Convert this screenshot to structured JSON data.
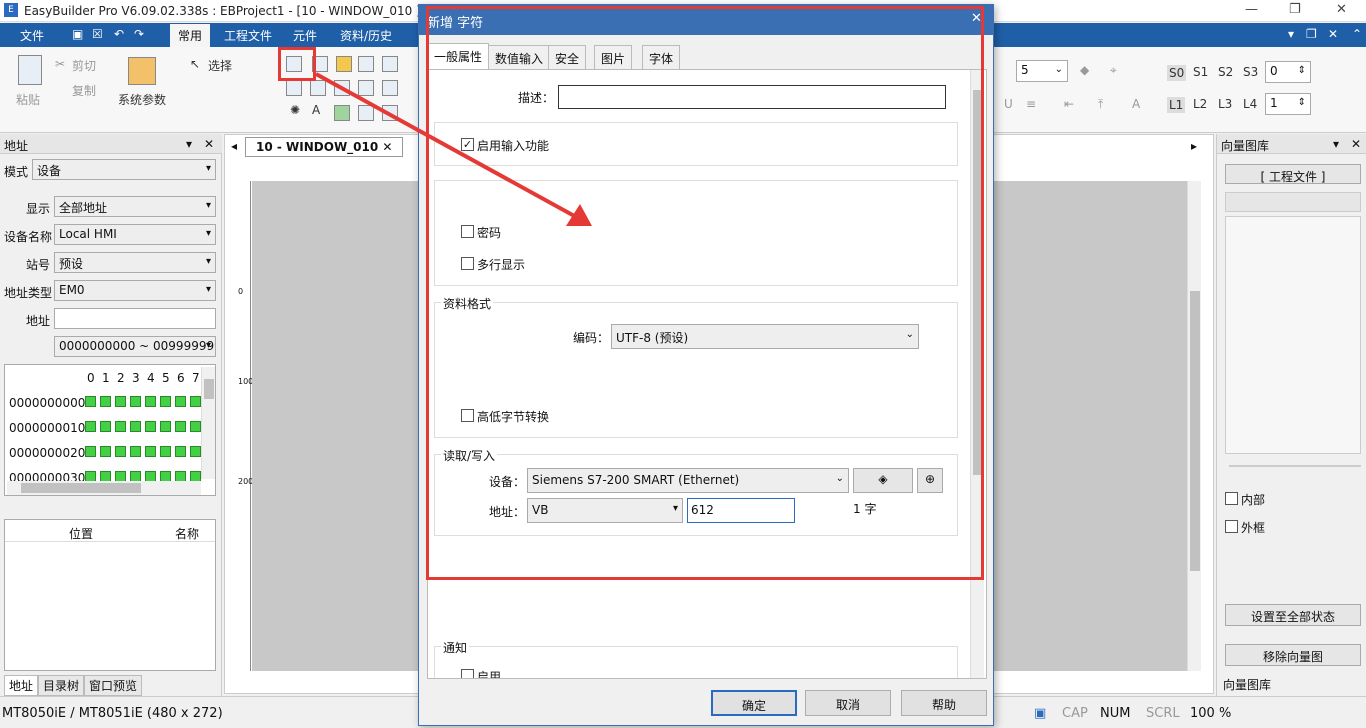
{
  "app": {
    "title": "EasyBuilder Pro V6.09.02.338s : EBProject1 - [10 - WINDOW_010 ]"
  },
  "menu": {
    "items": [
      "文件",
      "常用",
      "工程文件",
      "元件",
      "资料/历史"
    ]
  },
  "ribbon": {
    "paste": "粘贴",
    "cut": "剪切",
    "copy": "复制",
    "system_params": "系统参数",
    "select": "选择",
    "font_size": "5",
    "s_labels": [
      "S0",
      "S1",
      "S2",
      "S3"
    ],
    "s_value": "0",
    "l_labels": [
      "L1",
      "L2",
      "L3",
      "L4"
    ],
    "l_value": "1"
  },
  "left_panel": {
    "title": "地址",
    "mode_label": "模式",
    "mode_value": "设备",
    "display_label": "显示",
    "display_value": "全部地址",
    "device_name_label": "设备名称",
    "device_name_value": "Local HMI",
    "station_label": "站号",
    "station_value": "预设",
    "addr_type_label": "地址类型",
    "addr_type_value": "EM0",
    "address_label": "地址",
    "address_value": "",
    "range_value": "0000000000 ~ 0099999999",
    "grid_cols": [
      "0",
      "1",
      "2",
      "3",
      "4",
      "5",
      "6",
      "7"
    ],
    "grid_rows": [
      "0000000000",
      "0000000010",
      "0000000020",
      "0000000030"
    ],
    "list_headers": [
      "位置",
      "名称"
    ],
    "bottom_tabs": [
      "地址",
      "目录树",
      "窗口预览"
    ]
  },
  "document": {
    "tab_label": "10 - WINDOW_010",
    "ruler_marks": [
      "0",
      "100",
      "200"
    ]
  },
  "right_panel": {
    "title": "向量图库",
    "project_btn": "[ 工程文件 ]",
    "inner_label": "内部",
    "frame_label": "外框",
    "set_all_btn": "设置至全部状态",
    "remove_btn": "移除向量图",
    "bottom_tab": "向量图库"
  },
  "status": {
    "model": "MT8050iE / MT8051iE (480 x 272)",
    "cap": "CAP",
    "num": "NUM",
    "scrl": "SCRL",
    "zoom": "100 %"
  },
  "dialog": {
    "title": "新增 字符",
    "tabs": [
      "一般属性",
      "数值输入",
      "安全",
      "图片",
      "字体"
    ],
    "description_label": "描述：",
    "description_value": "",
    "enable_input_label": "启用输入功能",
    "password_label": "密码",
    "multiline_label": "多行显示",
    "data_format_title": "资料格式",
    "encoding_label": "编码：",
    "encoding_value": "UTF-8 (预设)",
    "byte_swap_label": "高低字节转换",
    "rw_title": "读取/写入",
    "device_label": "设备：",
    "device_value": "Siemens S7-200 SMART (Ethernet)",
    "address_label": "地址：",
    "address_type": "VB",
    "address_value": "612",
    "word_count": "1 字",
    "notify_title": "通知",
    "notify_enable": "启用",
    "ok": "确定",
    "cancel": "取消",
    "help": "帮助"
  },
  "colors": {
    "menubar": "#1f5fa8",
    "highlight": "#e53935",
    "grid_cell": "#44d044"
  }
}
